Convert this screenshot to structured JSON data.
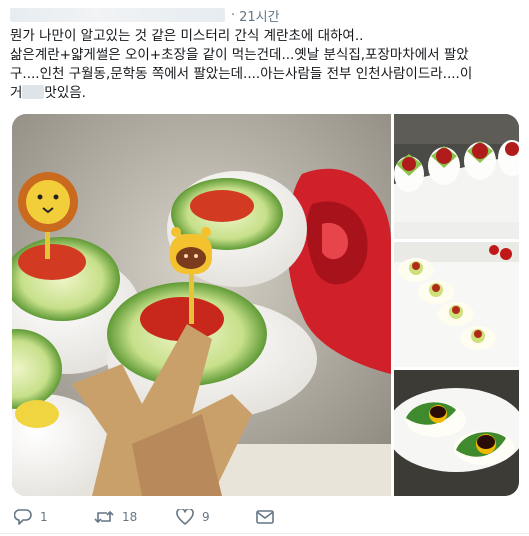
{
  "tweet": {
    "time_ago": "21시간",
    "separator": "·",
    "text_line1": "뭔가 나만이 알고있는 것 같은 미스터리 간식 계란초에 대하여..",
    "text_line2": "삶은계란+얇게썰은 오이+초장을 같이 먹는건데...옛날 분식집,포장마차에서 팔았",
    "text_line3": "구....인천 구월동,문학동 쪽에서 팔았는데....아는사람들 전부 인천사람이드라....이",
    "text_line4_a": "거",
    "text_line4_b": "맛있음."
  },
  "actions": {
    "reply_count": "1",
    "retweet_count": "18",
    "like_count": "9"
  },
  "colors": {
    "text": "#14171a",
    "muted": "#657786",
    "divider": "#e6ecf0"
  },
  "icons": [
    "reply-icon",
    "retweet-icon",
    "like-icon",
    "direct-message-icon"
  ]
}
